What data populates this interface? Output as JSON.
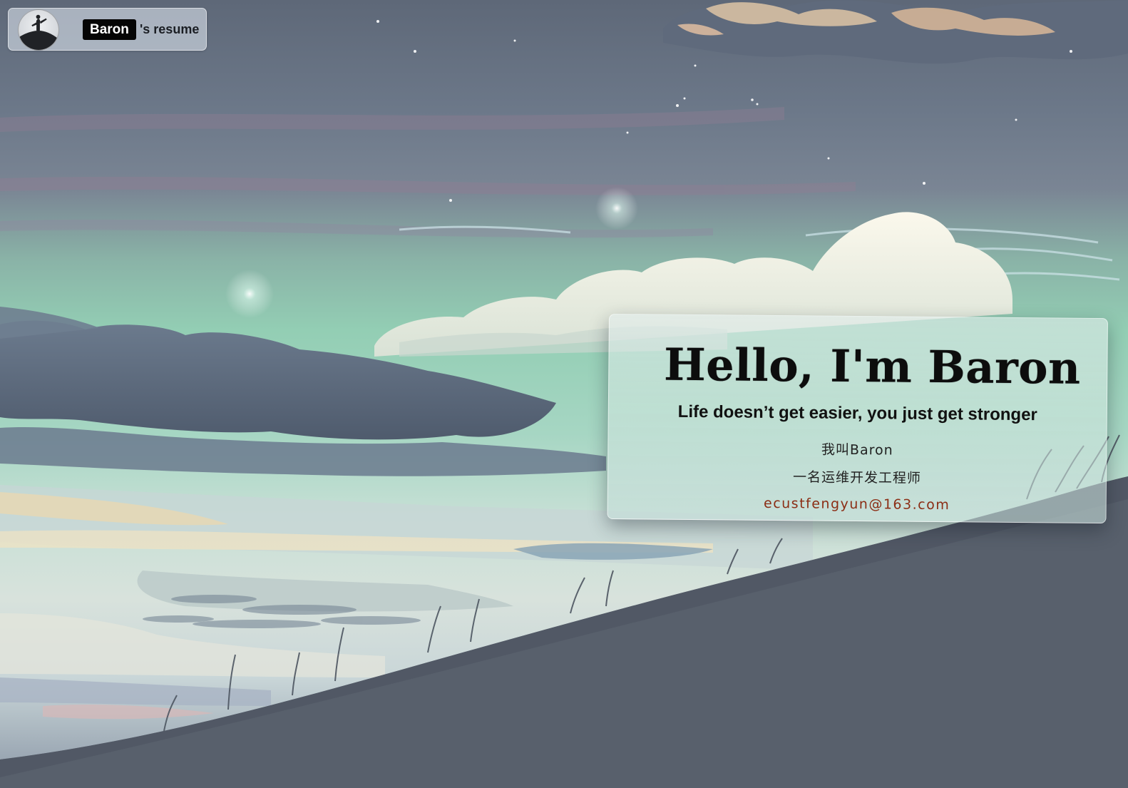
{
  "header": {
    "name": "Baron",
    "suffix": "'s resume",
    "avatar_icon": "silhouette-on-hill-icon"
  },
  "intro": {
    "title": "Hello, I'm Baron",
    "motto": "Life doesn’t get easier, you just get stronger",
    "name_line": "我叫Baron",
    "job_line": "一名运维开发工程师",
    "email": "ecustfengyun@163.com"
  },
  "colors": {
    "sky_top": "#5e6878",
    "sky_green": "#8ec9b1",
    "hill": "#58606c",
    "email": "#8b2d14",
    "name_badge": "#050505"
  }
}
